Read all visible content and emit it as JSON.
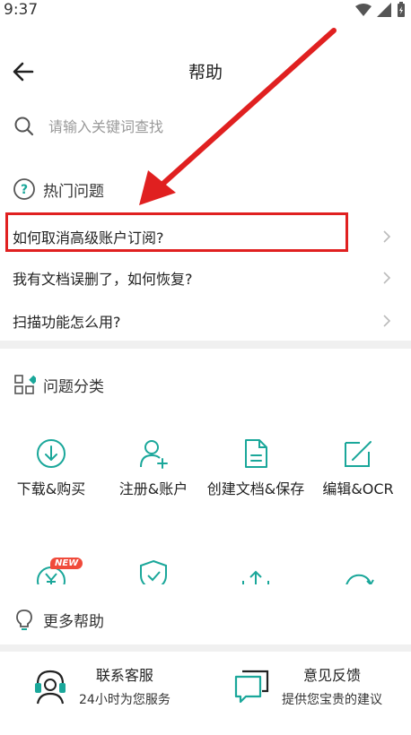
{
  "status_bar": {
    "time": "9:37"
  },
  "header": {
    "title": "帮助"
  },
  "search": {
    "placeholder": "请输入关键词查找"
  },
  "hot": {
    "title": "热门问题",
    "items": [
      {
        "label": "如何取消高级账户订阅?"
      },
      {
        "label": "我有文档误删了，如何恢复?"
      },
      {
        "label": "扫描功能怎么用?"
      }
    ]
  },
  "categories": {
    "title": "问题分类",
    "items": [
      {
        "label": "下载&购买",
        "icon": "download-icon"
      },
      {
        "label": "注册&账户",
        "icon": "add-user-icon"
      },
      {
        "label": "创建文档&保存",
        "icon": "document-icon"
      },
      {
        "label": "编辑&OCR",
        "icon": "edit-icon"
      }
    ],
    "badge": "NEW"
  },
  "more": {
    "title": "更多帮助"
  },
  "bottom": {
    "contact": {
      "title": "联系客服",
      "subtitle": "24小时为您服务"
    },
    "feedback": {
      "title": "意见反馈",
      "subtitle": "提供您宝贵的建议"
    }
  },
  "colors": {
    "accent": "#1aa79a",
    "highlight": "#e02020",
    "arrow": "#e02020",
    "badge": "#f04a3a"
  }
}
